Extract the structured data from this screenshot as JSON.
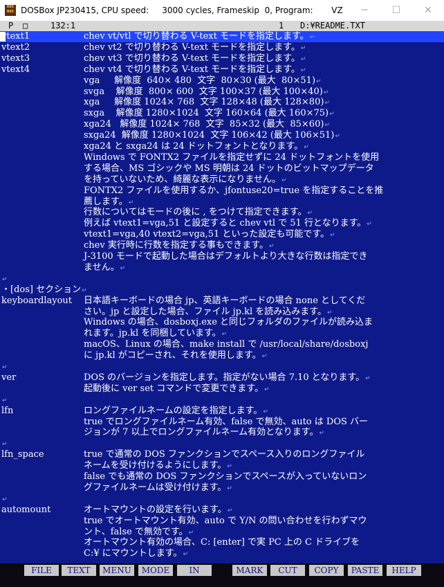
{
  "window": {
    "app_icon_text": "DOS BOX",
    "title": "DOSBox JP230415, CPU speed:     3000 cycles, Frameskip  0, Program:       VZ",
    "min_glyph": "─",
    "max_glyph": "☐",
    "close_glyph": "✕"
  },
  "status": {
    "mode": "P",
    "box": "□",
    "position": "132:1",
    "file_no": "1",
    "file_path": "D:¥README.TXT"
  },
  "return_mark": "↵",
  "lines": [
    {
      "key": "vtext1",
      "text": "chev vt/vtl で切り替わる V-text モードを指定します。",
      "ret": true
    },
    {
      "key": "vtext2",
      "text": "chev vt2 で切り替わる V-text モードを指定します。",
      "ret": true
    },
    {
      "key": "vtext3",
      "text": "chev vt3 で切り替わる V-text モードを指定します。",
      "ret": true
    },
    {
      "key": "vtext4",
      "text": "chev vt4 で切り替わる V-text モードを指定します。",
      "ret": true
    },
    {
      "key": "",
      "text": "vga     解像度  640× 480  文字  80×30 (最大  80×51)",
      "ret": true
    },
    {
      "key": "",
      "text": "svga    解像度  800× 600  文字 100×37 (最大 100×40)",
      "ret": true
    },
    {
      "key": "",
      "text": "xga     解像度 1024× 768  文字 128×48 (最大 128×80)",
      "ret": true
    },
    {
      "key": "",
      "text": "sxga    解像度 1280×1024  文字 160×64 (最大 160×75)",
      "ret": true
    },
    {
      "key": "",
      "text": "xga24   解像度 1024× 768  文字  85×32 (最大  85×60)",
      "ret": true
    },
    {
      "key": "",
      "text": "sxga24  解像度 1280×1024  文字 106×42 (最大 106×51)",
      "ret": true
    },
    {
      "key": "",
      "text": "xga24 と sxga24 は 24 ドットフォントとなります。",
      "ret": true
    },
    {
      "key": "",
      "text": "Windows で FONTX2 ファイルを指定せずに 24 ドットフォントを使用",
      "ret": false
    },
    {
      "key": "",
      "text": "する場合、MS ゴシックや MS 明朝は 24 ドットのビットマップデータ",
      "ret": false
    },
    {
      "key": "",
      "text": "を持っていないため、綺麗な表示になりません。",
      "ret": true
    },
    {
      "key": "",
      "text": "FONTX2 ファイルを使用するか、jfontuse20=true を指定することを推",
      "ret": false
    },
    {
      "key": "",
      "text": "薦します。",
      "ret": true
    },
    {
      "key": "",
      "text": "行数についてはモードの後に , をつけて指定できます。",
      "ret": true
    },
    {
      "key": "",
      "text": "例えば vtext1=vga,51 と設定すると chev vtl で 51 行となります。",
      "ret": true
    },
    {
      "key": "",
      "text": "vtext1=vga,40 vtext2=vga,51 といった設定も可能です。",
      "ret": true
    },
    {
      "key": "",
      "text": "chev 実行時に行数を指定する事もできます。",
      "ret": true
    },
    {
      "key": "",
      "text": "J-3100 モードで起動した場合はデフォルトより大きな行数は指定でき",
      "ret": false
    },
    {
      "key": "",
      "text": "ません。",
      "ret": true
    },
    {
      "key": "",
      "text": "",
      "ret": true
    },
    {
      "key": "・[dos] セクション",
      "text": "",
      "ret": true
    },
    {
      "key": "keyboardlayout",
      "text": "日本語キーボードの場合 jp、英語キーボードの場合 none としてくだ",
      "ret": false
    },
    {
      "key": "",
      "text": "さい。jp と設定した場合、ファイル jp.kl を読み込みます。",
      "ret": true
    },
    {
      "key": "",
      "text": "Windows の場合、dosboxj.exe と同じフォルダのファイルが読み込ま",
      "ret": false
    },
    {
      "key": "",
      "text": "れます。jp.kl を同梱しています。",
      "ret": true
    },
    {
      "key": "",
      "text": "macOS、Linux の場合、make install で /usr/local/share/dosboxj",
      "ret": false
    },
    {
      "key": "",
      "text": "に jp.kl がコピーされ、それを使用します。",
      "ret": true
    },
    {
      "key": "",
      "text": "",
      "ret": true
    },
    {
      "key": "ver",
      "text": "DOS のバージョンを指定します。指定がない場合 7.10 となります。",
      "ret": true
    },
    {
      "key": "",
      "text": "起動後に ver set コマンドで変更できます。",
      "ret": true
    },
    {
      "key": "",
      "text": "",
      "ret": true
    },
    {
      "key": "lfn",
      "text": "ロングファイルネームの設定を指定します。",
      "ret": true
    },
    {
      "key": "",
      "text": "true でロングファイルネーム有効、false で無効、auto は DOS バー",
      "ret": false
    },
    {
      "key": "",
      "text": "ジョンが 7 以上でロングファイルネーム有効となります。",
      "ret": true
    },
    {
      "key": "",
      "text": "",
      "ret": true
    },
    {
      "key": "lfn_space",
      "text": "true で通常の DOS ファンクションでスペース入りのロングファイル",
      "ret": false
    },
    {
      "key": "",
      "text": "ネームを受け付けるようにします。",
      "ret": true
    },
    {
      "key": "",
      "text": "false でも通常の DOS ファンクションでスペースが入っていないロン",
      "ret": false
    },
    {
      "key": "",
      "text": "グファイルネームは受け付けます。",
      "ret": true
    },
    {
      "key": "",
      "text": "",
      "ret": true
    },
    {
      "key": "automount",
      "text": "オートマウントの設定を行います。",
      "ret": true
    },
    {
      "key": "",
      "text": "true でオートマウント有効、auto で Y/N の問い合わせを行わずマウ",
      "ret": false
    },
    {
      "key": "",
      "text": "ント、false で無効です。",
      "ret": true
    },
    {
      "key": "",
      "text": "オートマウント有効の場合、C: [enter] で実 PC 上の C ドライブを",
      "ret": false
    },
    {
      "key": "",
      "text": "C:¥ にマウントします。",
      "ret": true
    }
  ],
  "function_keys": [
    "FILE",
    "TEXT",
    "MENU",
    "MODE",
    "IN",
    "MARK",
    "CUT",
    "COPY",
    "PASTE",
    "HELP"
  ]
}
